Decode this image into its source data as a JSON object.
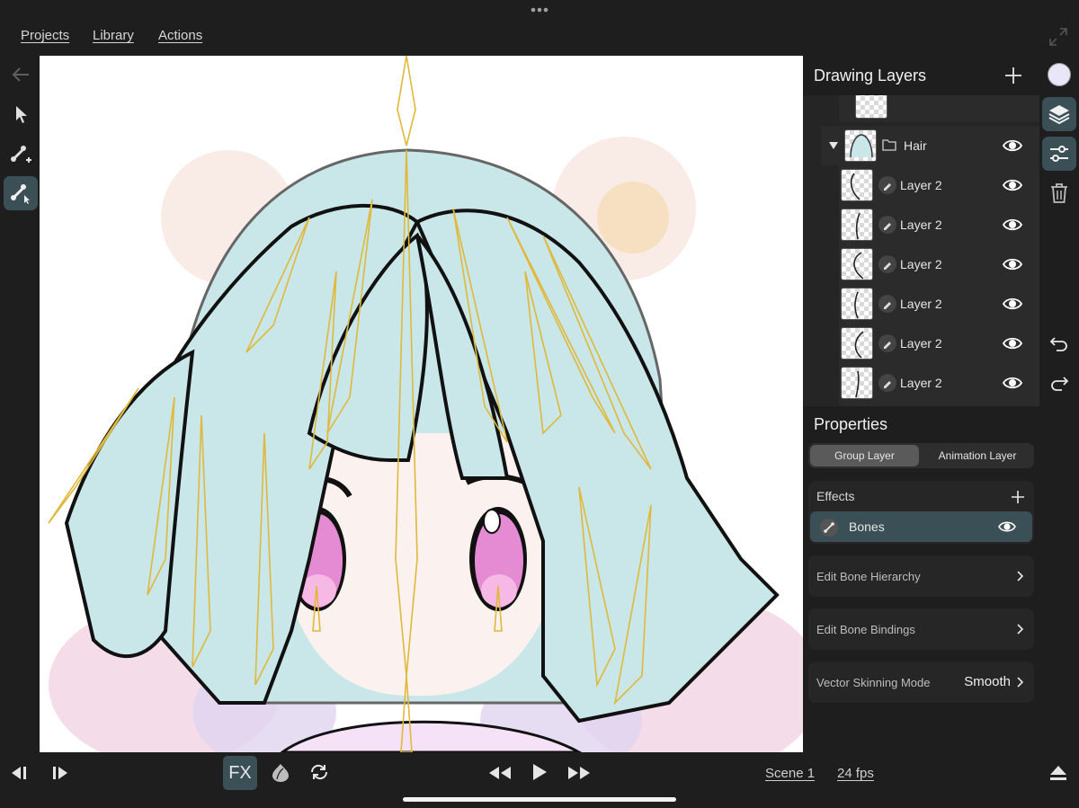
{
  "menu": {
    "projects": "Projects",
    "library": "Library",
    "actions": "Actions"
  },
  "left_tools": [
    {
      "icon": "back-arrow-icon"
    },
    {
      "icon": "select-arrow-icon"
    },
    {
      "icon": "add-bone-icon"
    },
    {
      "icon": "bone-select-icon",
      "active": true
    }
  ],
  "layers_panel": {
    "title": "Drawing Layers",
    "group": {
      "label": "Hair",
      "expanded": true
    },
    "layers": [
      {
        "label": "Layer 2"
      },
      {
        "label": "Layer 2"
      },
      {
        "label": "Layer 2"
      },
      {
        "label": "Layer 2"
      },
      {
        "label": "Layer 2"
      },
      {
        "label": "Layer 2"
      },
      {
        "label": "Layer 2"
      }
    ]
  },
  "properties": {
    "title": "Properties",
    "tabs": [
      {
        "label": "Group Layer",
        "active": true
      },
      {
        "label": "Animation Layer",
        "active": false
      }
    ],
    "effects_label": "Effects",
    "effect_item": "Bones",
    "rows": {
      "hierarchy": "Edit Bone Hierarchy",
      "bindings": "Edit Bone Bindings",
      "skinning_label": "Vector Skinning Mode",
      "skinning_value": "Smooth"
    }
  },
  "bottom": {
    "fx_label": "FX",
    "scene_label": "Scene 1",
    "fps_label": "24 fps"
  },
  "colors": {
    "accent": "#3a4f56",
    "panel": "#1e1e1e",
    "hair": "#c9e6e8",
    "bone": "#e0b83a",
    "eye": "#e58bd3",
    "color_swatch": "#e9e6f8"
  }
}
